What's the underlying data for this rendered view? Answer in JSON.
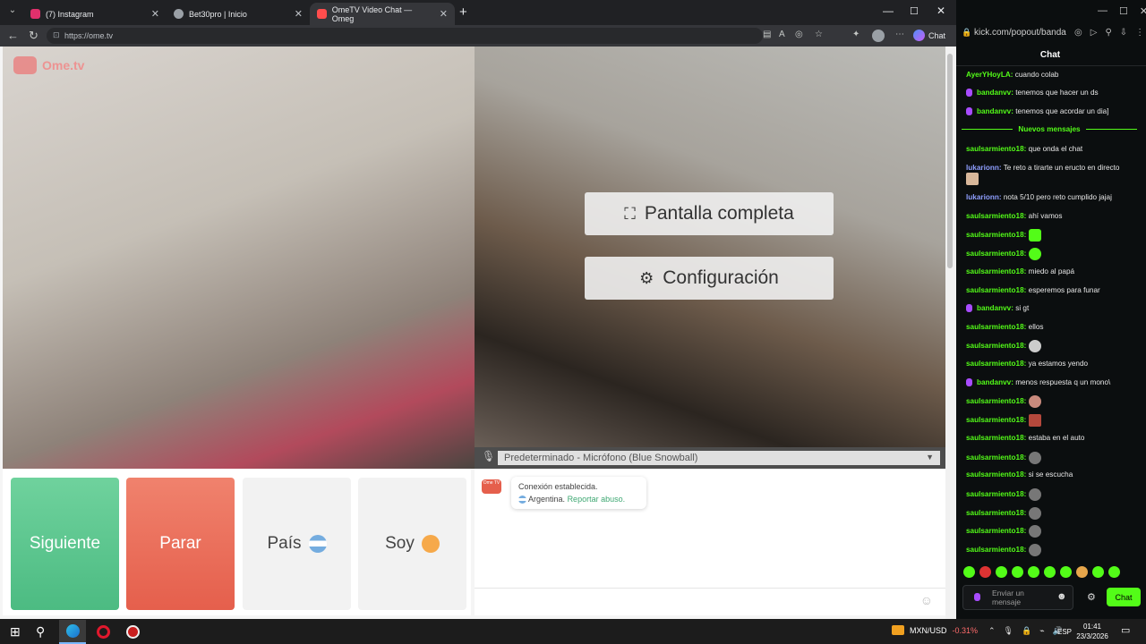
{
  "browser": {
    "tabs": [
      {
        "title": "(7) Instagram",
        "color": "#e1306c"
      },
      {
        "title": "Bet30pro | Inicio",
        "color": "#9aa0a6"
      },
      {
        "title": "OmeTV Video Chat — Omeg",
        "color": "#ff4d4d"
      }
    ],
    "url": "https://ome.tv",
    "chat_btn": "Chat"
  },
  "ometv": {
    "logo": "Ome.tv",
    "logo_small": "Ome TV",
    "fullscreen": "Pantalla completa",
    "settings": "Configuración",
    "mic": "Predeterminado - Micrófono (Blue Snowball)",
    "buttons": {
      "next": "Siguiente",
      "stop": "Parar",
      "country": "País",
      "soy": "Soy"
    },
    "status": {
      "line1": "Conexión establecida.",
      "country": "Argentina.",
      "report": "Reportar abuso."
    }
  },
  "kick": {
    "url": "kick.com/popout/banda",
    "title": "Chat",
    "new_label": "Nuevos mensajes",
    "send_placeholder": "Enviar un mensaje",
    "send_btn": "Chat",
    "messages": [
      {
        "user": "AyerYHoyLA:",
        "text": "cuando colab",
        "badge": false
      },
      {
        "user": "bandanvv:",
        "text": "tenemos que hacer un ds",
        "badge": true
      },
      {
        "user": "bandanvv:",
        "text": "tenemos que acordar un dia]",
        "badge": true
      },
      {
        "user": "saulsarmiento18:",
        "text": "que onda el chat",
        "badge": false
      },
      {
        "user": "lukarionn:",
        "text": "Te reto a tirarte un eructo en directo",
        "badge": false
      },
      {
        "user": "lukarionn:",
        "text": "nota 5/10 pero reto cumplido jajaj",
        "badge": false
      },
      {
        "user": "saulsarmiento18:",
        "text": "ahí vamos",
        "badge": false
      },
      {
        "user": "saulsarmiento18:",
        "text": "",
        "badge": false
      },
      {
        "user": "saulsarmiento18:",
        "text": "",
        "badge": false
      },
      {
        "user": "saulsarmiento18:",
        "text": "miedo al papá",
        "badge": false
      },
      {
        "user": "saulsarmiento18:",
        "text": "esperemos para funar",
        "badge": false
      },
      {
        "user": "bandanvv:",
        "text": "si gt",
        "badge": true
      },
      {
        "user": "saulsarmiento18:",
        "text": "ellos",
        "badge": false
      },
      {
        "user": "saulsarmiento18:",
        "text": "",
        "badge": false
      },
      {
        "user": "saulsarmiento18:",
        "text": "ya estamos yendo",
        "badge": false
      },
      {
        "user": "bandanvv:",
        "text": "menos respuesta q un mono\\",
        "badge": true
      },
      {
        "user": "saulsarmiento18:",
        "text": "",
        "badge": false
      },
      {
        "user": "saulsarmiento18:",
        "text": "",
        "badge": false
      },
      {
        "user": "saulsarmiento18:",
        "text": "estaba en el auto",
        "badge": false
      },
      {
        "user": "saulsarmiento18:",
        "text": "",
        "badge": false
      },
      {
        "user": "saulsarmiento18:",
        "text": "si se escucha",
        "badge": false
      },
      {
        "user": "saulsarmiento18:",
        "text": "",
        "badge": false
      },
      {
        "user": "saulsarmiento18:",
        "text": "",
        "badge": false
      },
      {
        "user": "saulsarmiento18:",
        "text": "",
        "badge": false
      },
      {
        "user": "saulsarmiento18:",
        "text": "",
        "badge": false
      }
    ]
  },
  "taskbar": {
    "ticker": "MXN/USD",
    "change": "-0.31%",
    "lang": "ESP",
    "time": "01:41",
    "date": "23/3/2026"
  }
}
